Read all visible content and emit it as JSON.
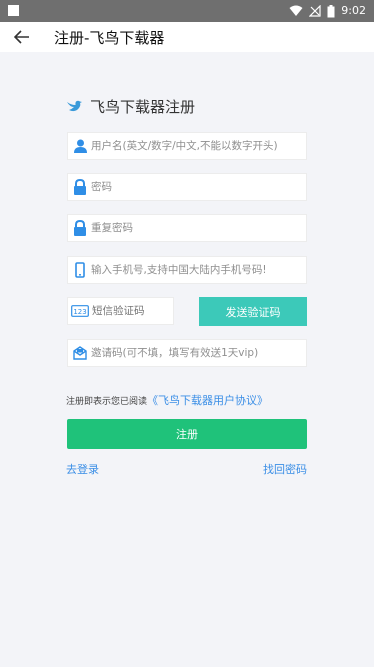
{
  "status_bar": {
    "time": "9:02"
  },
  "appbar": {
    "title": "注册-飞鸟下载器"
  },
  "brand": {
    "name": "飞鸟下载器注册"
  },
  "form": {
    "username_placeholder": "用户名(英文/数字/中文,不能以数字开头)",
    "password_placeholder": "密码",
    "confirm_password_placeholder": "重复密码",
    "phone_placeholder": "输入手机号,支持中国大陆内手机号码!",
    "sms_code_placeholder": "短信验证码",
    "send_code_label": "发送验证码",
    "invite_placeholder": "邀请码(可不填，填写有效送1天vip)"
  },
  "agreement": {
    "prefix": "注册即表示您已阅读",
    "link": "《飞鸟下载器用户协议》"
  },
  "submit_label": "注册",
  "footer": {
    "login_label": "去登录",
    "recover_label": "找回密码"
  },
  "colors": {
    "accent_teal": "#3cc9b9",
    "submit_green": "#1fc27a",
    "link_blue": "#3a8ee6",
    "icon_blue": "#2f8ee6"
  }
}
